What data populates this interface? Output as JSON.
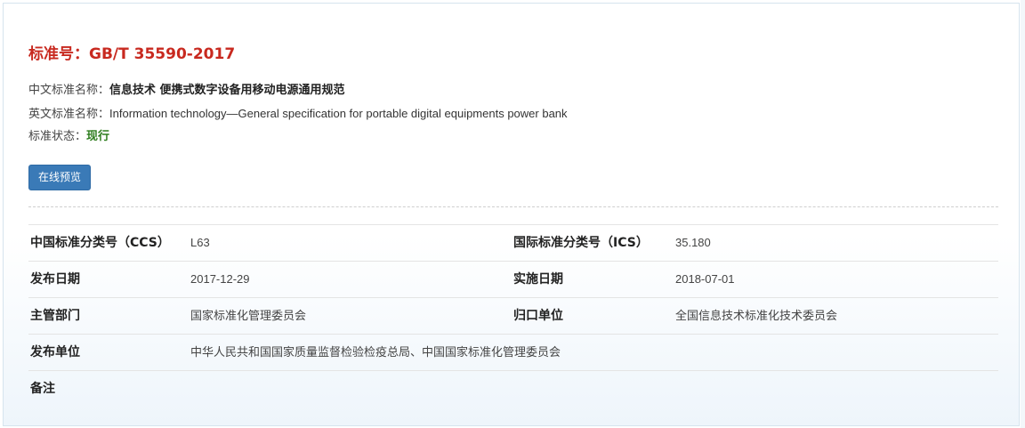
{
  "header": {
    "title": "标准号：GB/T 35590-2017"
  },
  "info": {
    "cn_name_label": "中文标准名称：",
    "cn_name_value": "信息技术 便携式数字设备用移动电源通用规范",
    "en_name_label": "英文标准名称：",
    "en_name_value": "Information technology—General specification for portable digital equipments power bank",
    "status_label": "标准状态：",
    "status_value": "现行"
  },
  "actions": {
    "preview_label": "在线预览"
  },
  "meta": {
    "ccs_label": "中国标准分类号（CCS）",
    "ccs_value": "L63",
    "ics_label": "国际标准分类号（ICS）",
    "ics_value": "35.180",
    "publish_date_label": "发布日期",
    "publish_date_value": "2017-12-29",
    "effective_date_label": "实施日期",
    "effective_date_value": "2018-07-01",
    "authority_label": "主管部门",
    "authority_value": "国家标准化管理委员会",
    "centralized_label": "归口单位",
    "centralized_value": "全国信息技术标准化技术委员会",
    "publisher_label": "发布单位",
    "publisher_value": "中华人民共和国国家质量监督检验检疫总局、中国国家标准化管理委员会",
    "remarks_label": "备注",
    "remarks_value": ""
  },
  "colors": {
    "title": "#c8291f",
    "status": "#2e7d1e",
    "button": "#3a7ab7"
  }
}
